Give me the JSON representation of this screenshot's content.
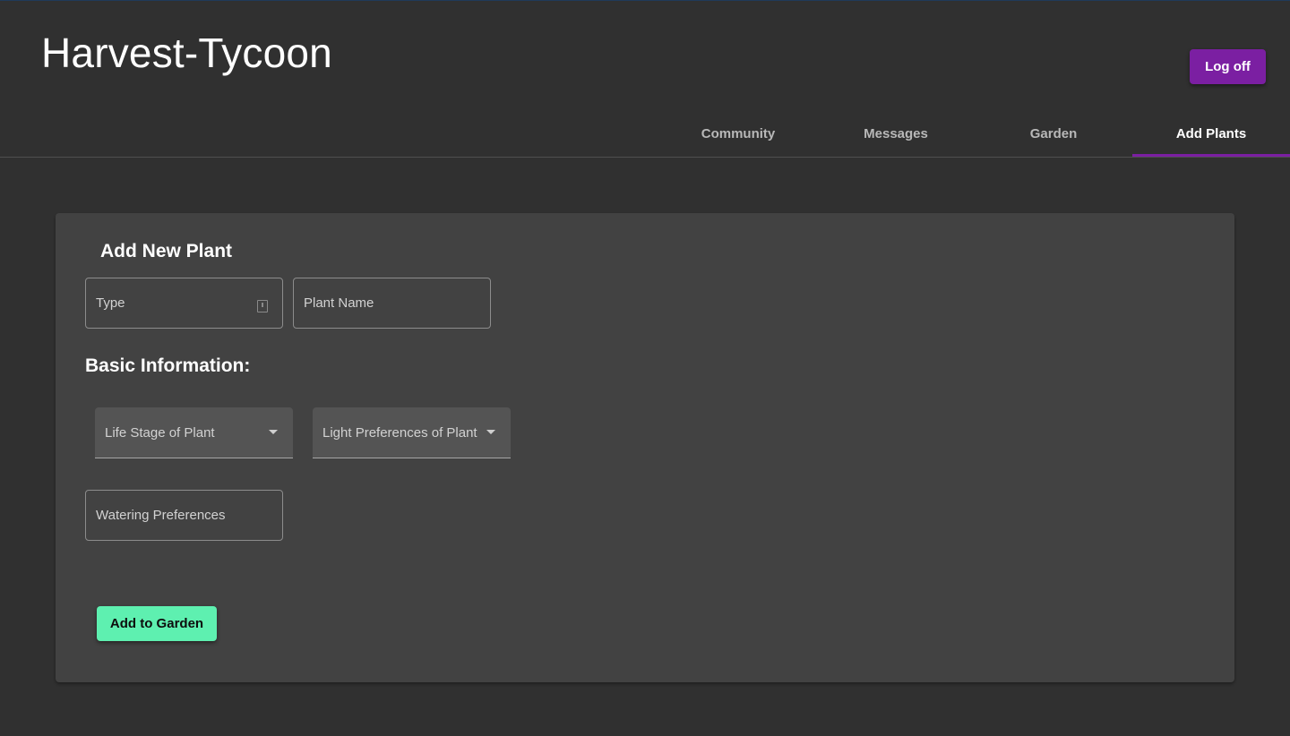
{
  "app": {
    "title": "Harvest-Tycoon"
  },
  "header": {
    "logoff_label": "Log off"
  },
  "tabs": [
    {
      "label": "Community",
      "active": false
    },
    {
      "label": "Messages",
      "active": false
    },
    {
      "label": "Garden",
      "active": false
    },
    {
      "label": "Add Plants",
      "active": true
    }
  ],
  "form": {
    "title": "Add New Plant",
    "type_field": {
      "placeholder": "Type",
      "icon": "file-icon"
    },
    "plant_name_field": {
      "placeholder": "Plant Name"
    },
    "basic_info_title": "Basic Information:",
    "life_stage_select": {
      "label": "Life Stage of Plant",
      "icon": "chevron-down-icon"
    },
    "light_pref_select": {
      "label": "Light Preferences of Plant",
      "icon": "chevron-down-icon"
    },
    "watering_field": {
      "placeholder": "Watering Preferences"
    },
    "submit_label": "Add to Garden"
  },
  "colors": {
    "background": "#303030",
    "card": "#424242",
    "accent_purple": "#7b1fa2",
    "accent_green": "#5ef0b0"
  }
}
